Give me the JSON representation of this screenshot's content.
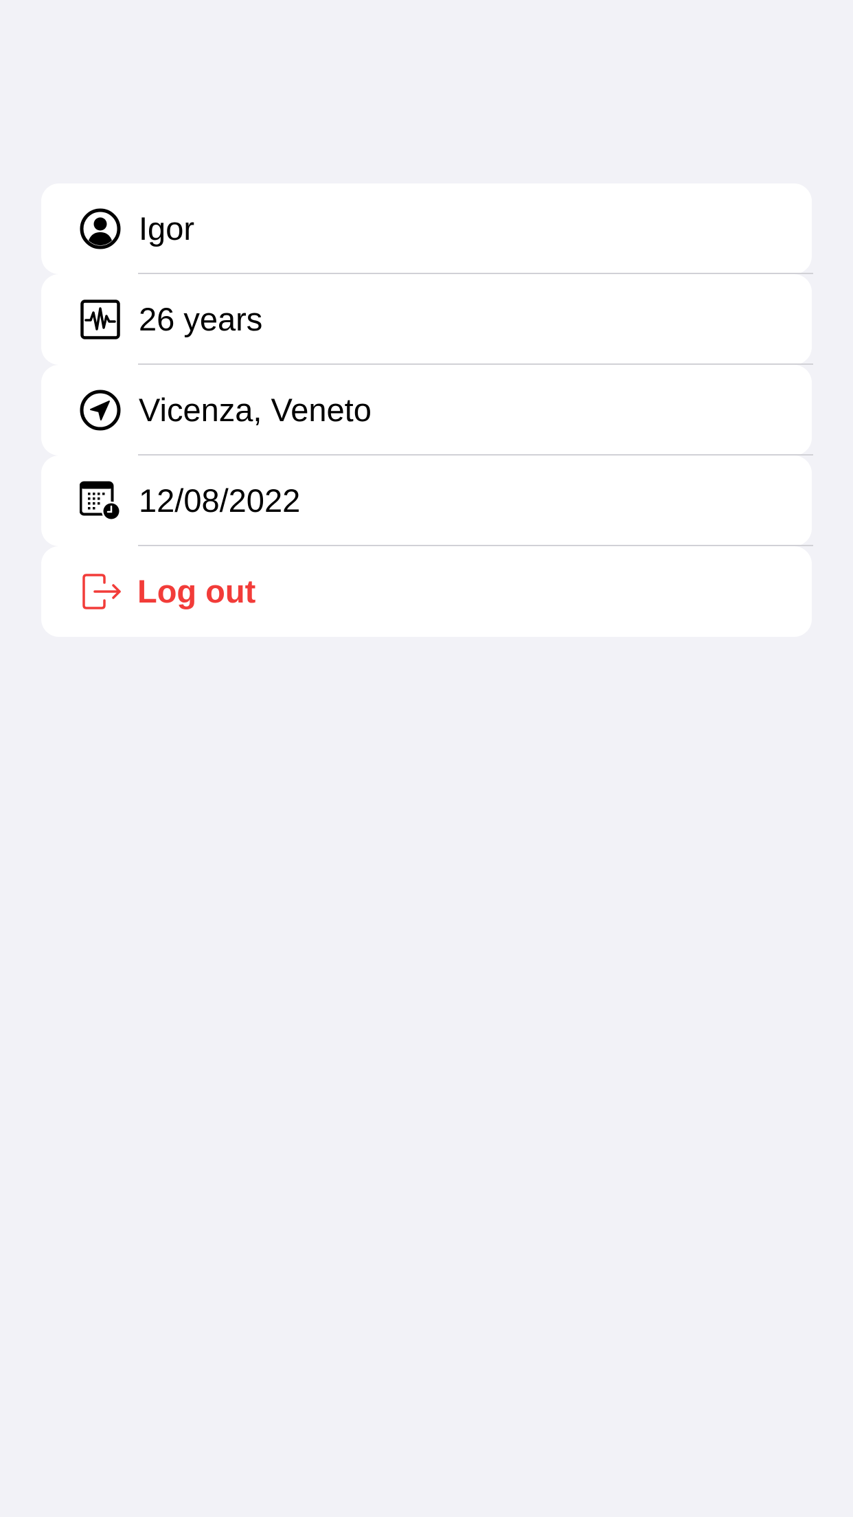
{
  "profile": {
    "rows": [
      {
        "label": "Igor",
        "icon": "person-circle-icon"
      },
      {
        "label": "26 years",
        "icon": "waveform-monitor-icon"
      },
      {
        "label": "Vicenza, Veneto",
        "icon": "location-arrow-icon"
      },
      {
        "label": "12/08/2022",
        "icon": "calendar-clock-icon"
      }
    ],
    "logout": {
      "label": "Log out",
      "icon": "logout-arrow-icon"
    }
  },
  "colors": {
    "background": "#f2f2f7",
    "row_background": "#ffffff",
    "divider": "#d1d1d6",
    "text": "#000000",
    "destructive": "#f23c39"
  }
}
